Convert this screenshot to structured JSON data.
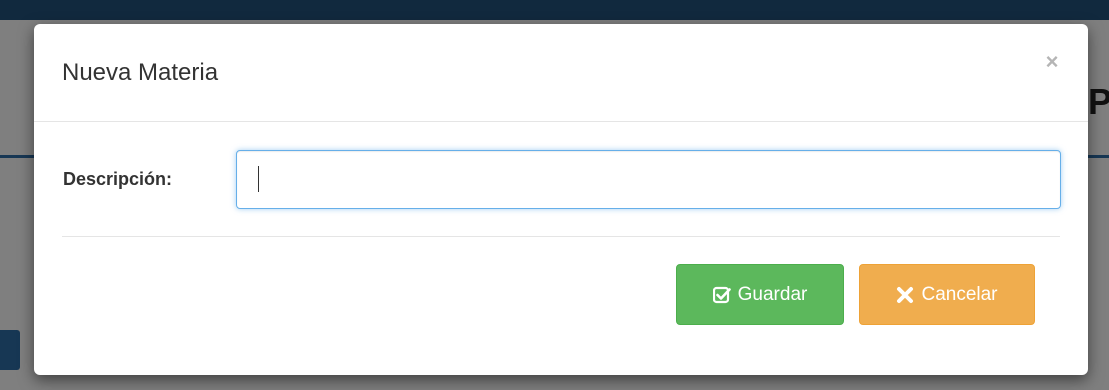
{
  "modal": {
    "title": "Nueva Materia",
    "close_symbol": "×"
  },
  "form": {
    "description_label": "Descripción:",
    "description_value": "",
    "description_placeholder": ""
  },
  "footer": {
    "save_label": "Guardar",
    "save_icon": "check-square-icon",
    "cancel_label": "Cancelar",
    "cancel_icon": "close-x-icon"
  },
  "background": {
    "heading_fragment": "P"
  },
  "colors": {
    "save_button": "#5cb85c",
    "cancel_button": "#f0ad4e",
    "input_focus_border": "#66afe9",
    "topbar": "#22537d"
  }
}
